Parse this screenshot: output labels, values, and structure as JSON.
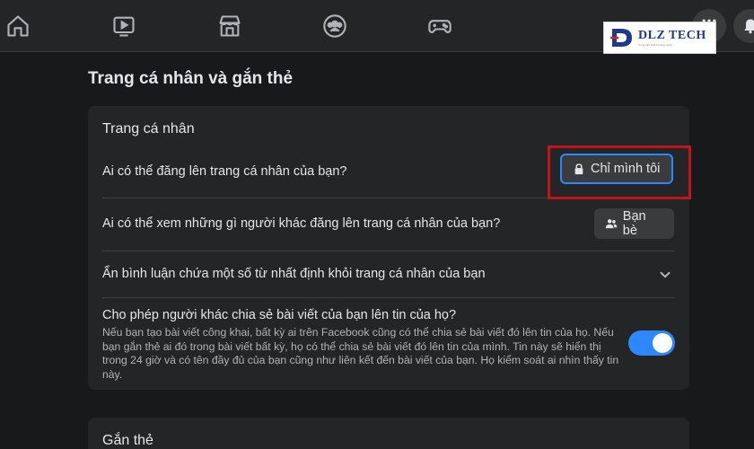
{
  "logo": {
    "text": "DLZ TECH",
    "tagline": "Cung cấp thiết bị công nghệ"
  },
  "page_title": "Trang cá nhân và gắn thẻ",
  "profile_section": {
    "title": "Trang cá nhân",
    "rows": [
      {
        "label": "Ai có thể đăng lên trang cá nhân của bạn?",
        "value": "Chỉ mình tôi",
        "icon": "lock-icon"
      },
      {
        "label": "Ai có thể xem những gì người khác đăng lên trang cá nhân của bạn?",
        "value": "Bạn bè",
        "icon": "friends-icon"
      },
      {
        "label": "Ẩn bình luận chứa một số từ nhất định khỏi trang cá nhân của bạn",
        "icon": "chevron-down-icon"
      },
      {
        "label": "Cho phép người khác chia sẻ bài viết của bạn lên tin của họ?",
        "description": "Nếu bạn tạo bài viết công khai, bất kỳ ai trên Facebook cũng có thể chia sẻ bài viết đó lên tin của họ. Nếu bạn gắn thẻ ai đó trong bài viết bất kỳ, họ có thể chia sẻ bài viết đó lên tin của mình. Tin này sẽ hiển thị trong 24 giờ và có tên đầy đủ của bạn cũng như liên kết đến bài viết của bạn. Họ kiểm soát ai nhìn thấy tin này.",
        "toggle_on": true
      }
    ]
  },
  "tagging_section": {
    "title": "Gắn thẻ"
  },
  "colors": {
    "background": "#18191a",
    "card": "#242526",
    "accent": "#2d88ff",
    "highlight": "#c0151c"
  }
}
